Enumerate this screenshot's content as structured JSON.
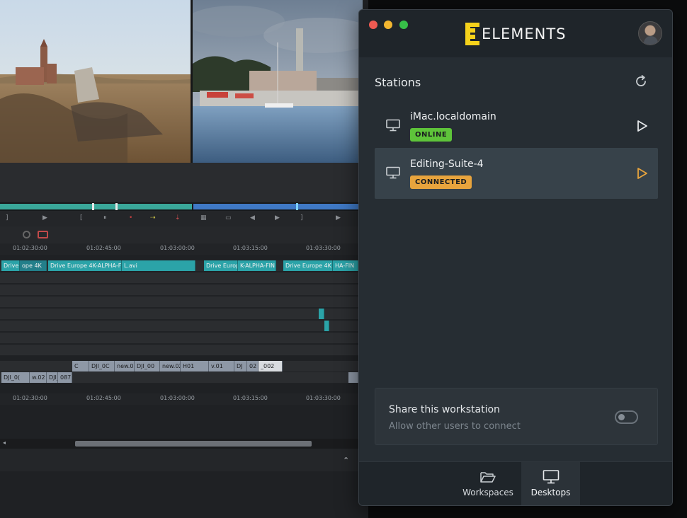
{
  "editor": {
    "ruler_top": [
      "01:02:30:00",
      "01:02:45:00",
      "01:03:00:00",
      "01:03:15:00",
      "01:03:30:00"
    ],
    "ruler_bottom": [
      "01:02:30:00",
      "01:02:45:00",
      "01:03:00:00",
      "01:03:15:00",
      "01:03:30:00"
    ],
    "clips_top": [
      "Drive E",
      "ope 4K",
      "Drive Europe 4K-ALPHA-F",
      "L.avi",
      "Drive Europ",
      "K-ALPHA-FIN",
      "Drive Europe 4K",
      "HA-FIN"
    ],
    "clips_mid": [
      "C",
      "DJI_0C",
      "new.01",
      "DJI_00",
      "new.02",
      "H01",
      "v.01",
      "DJ",
      "02",
      "_002"
    ],
    "clips_low": [
      "DJI_0(",
      "w.02",
      "DJI_0",
      "087"
    ]
  },
  "window": {
    "brand": "ELEMENTS",
    "stations_title": "Stations",
    "stations": [
      {
        "name": "iMac.localdomain",
        "status": "ONLINE",
        "status_color": "#5ec43a"
      },
      {
        "name": "Editing-Suite-4",
        "status": "CONNECTED",
        "status_color": "#e8a43d"
      }
    ],
    "share": {
      "title": "Share this workstation",
      "subtitle": "Allow other users to connect",
      "enabled": false
    },
    "tabs": [
      {
        "label": "Workspaces",
        "icon": "folder-open-icon"
      },
      {
        "label": "Desktops",
        "icon": "monitor-icon",
        "active": true
      }
    ],
    "colors": {
      "accent": "#f5d21b",
      "play_active": "#e8a43d"
    }
  }
}
